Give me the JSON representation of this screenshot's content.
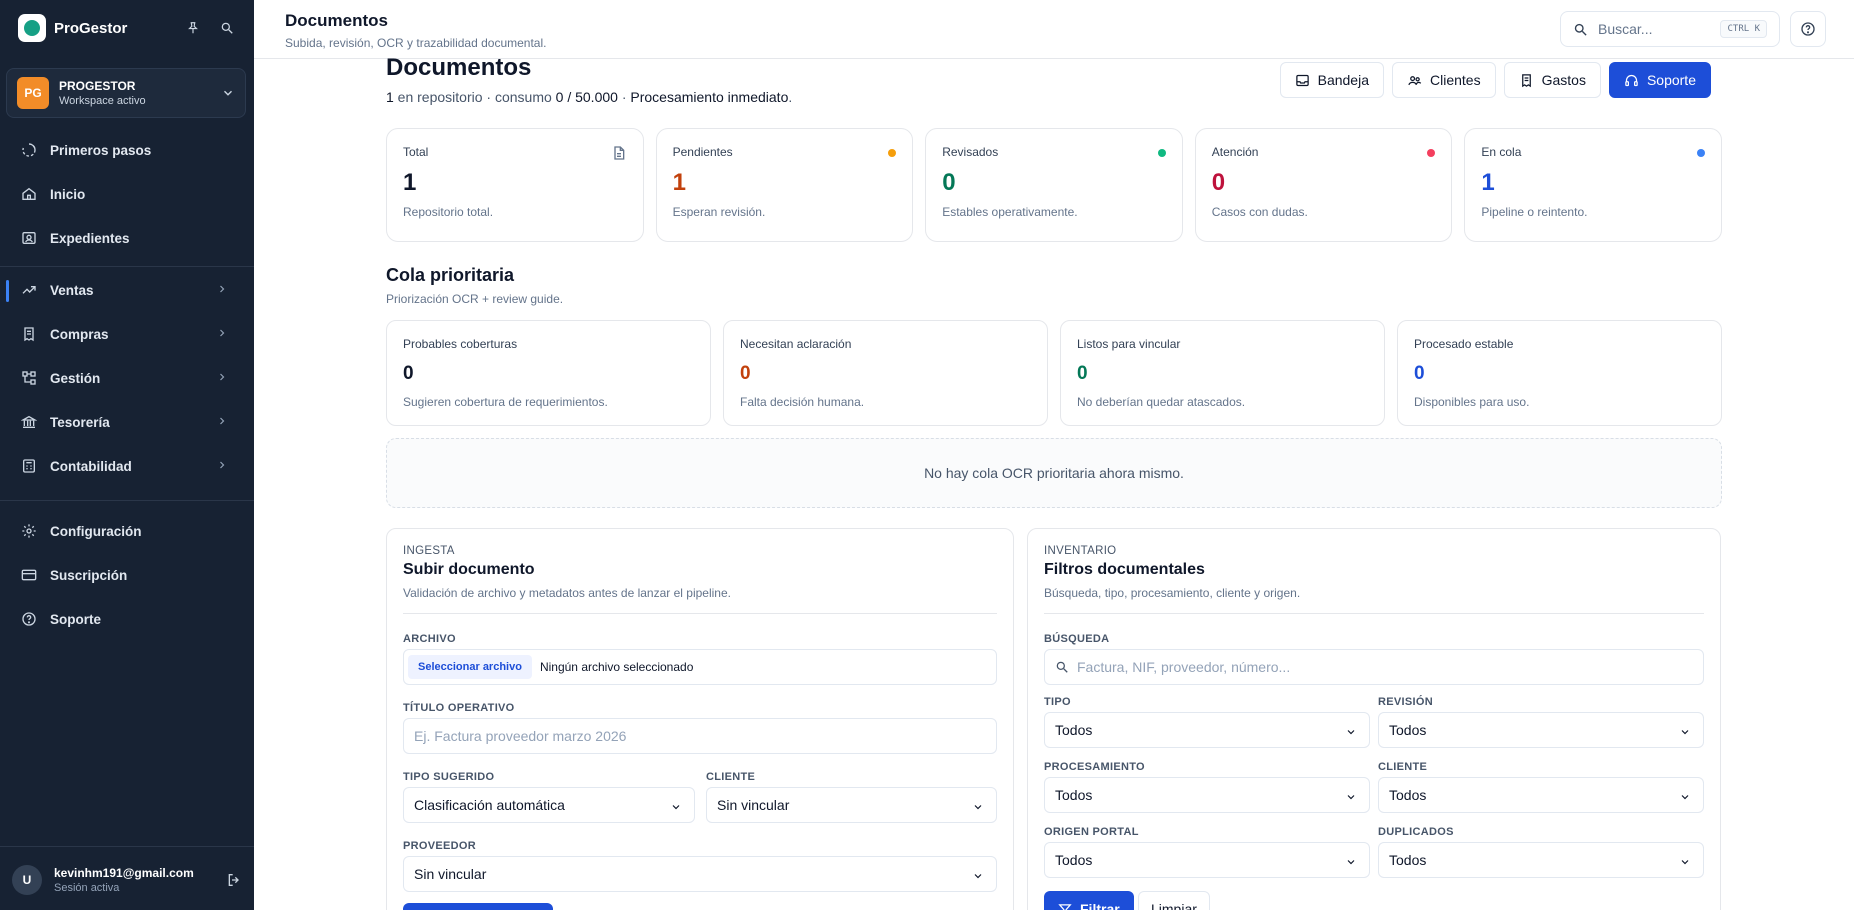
{
  "sidebar": {
    "brand": "ProGestor",
    "workspace": {
      "initials": "PG",
      "name": "PROGESTOR",
      "status": "Workspace activo"
    },
    "items": [
      {
        "label": "Primeros pasos",
        "icon": "circle-progress-icon"
      },
      {
        "label": "Inicio",
        "icon": "home-icon"
      },
      {
        "label": "Expedientes",
        "icon": "folder-user-icon"
      },
      {
        "label": "Ventas",
        "icon": "trending-up-icon"
      },
      {
        "label": "Compras",
        "icon": "receipt-icon"
      },
      {
        "label": "Gestión",
        "icon": "workflow-icon"
      },
      {
        "label": "Tesorería",
        "icon": "bank-icon"
      },
      {
        "label": "Contabilidad",
        "icon": "calculator-icon"
      },
      {
        "label": "Configuración",
        "icon": "gear-icon"
      },
      {
        "label": "Suscripción",
        "icon": "credit-card-icon"
      },
      {
        "label": "Soporte",
        "icon": "help-circle-icon"
      }
    ],
    "user": {
      "initial": "U",
      "email": "kevinhm191@gmail.com",
      "status": "Sesión activa"
    }
  },
  "header": {
    "title": "Documentos",
    "subtitle": "Subida, revisión, OCR y trazabilidad documental.",
    "search_placeholder": "Buscar...",
    "shortcut": "CTRL K"
  },
  "page": {
    "title": "Documentos",
    "repo_count": "1",
    "repo_text": " en repositorio · consumo ",
    "usage": "0 / 50.000",
    "processing_sep": " · ",
    "processing": "Procesamiento inmediato",
    "processing_end": ".",
    "actions": [
      "Bandeja",
      "Clientes",
      "Gastos",
      "Soporte"
    ]
  },
  "stats": [
    {
      "label": "Total",
      "value": "1",
      "desc": "Repositorio total.",
      "color": "#0f172a"
    },
    {
      "label": "Pendientes",
      "value": "1",
      "desc": "Esperan revisión.",
      "color": "#c2410c",
      "dot": "#f59e0b"
    },
    {
      "label": "Revisados",
      "value": "0",
      "desc": "Estables operativamente.",
      "color": "#047857",
      "dot": "#10b981"
    },
    {
      "label": "Atención",
      "value": "0",
      "desc": "Casos con dudas.",
      "color": "#be123c",
      "dot": "#f43f5e"
    },
    {
      "label": "En cola",
      "value": "1",
      "desc": "Pipeline o reintento.",
      "color": "#1d4ed8",
      "dot": "#3b82f6"
    }
  ],
  "queue": {
    "title": "Cola prioritaria",
    "subtitle": "Priorización OCR + review guide.",
    "cards": [
      {
        "label": "Probables coberturas",
        "value": "0",
        "desc": "Sugieren cobertura de requerimientos.",
        "color": "#0f172a"
      },
      {
        "label": "Necesitan aclaración",
        "value": "0",
        "desc": "Falta decisión humana.",
        "color": "#c2410c"
      },
      {
        "label": "Listos para vincular",
        "value": "0",
        "desc": "No deberían quedar atascados.",
        "color": "#047857"
      },
      {
        "label": "Procesado estable",
        "value": "0",
        "desc": "Disponibles para uso.",
        "color": "#1d4ed8"
      }
    ],
    "empty": "No hay cola OCR prioritaria ahora mismo."
  },
  "ingesta": {
    "eyebrow": "INGESTA",
    "title": "Subir documento",
    "subtitle": "Validación de archivo y metadatos antes de lanzar el pipeline.",
    "file_label": "ARCHIVO",
    "file_button": "Seleccionar archivo",
    "file_none": "Ningún archivo seleccionado",
    "title_label": "TÍTULO OPERATIVO",
    "title_placeholder": "Ej. Factura proveedor marzo 2026",
    "type_label": "TIPO SUGERIDO",
    "type_value": "Clasificación automática",
    "client_label": "CLIENTE",
    "client_value": "Sin vincular",
    "provider_label": "PROVEEDOR",
    "provider_value": "Sin vincular"
  },
  "inventario": {
    "eyebrow": "INVENTARIO",
    "title": "Filtros documentales",
    "subtitle": "Búsqueda, tipo, procesamiento, cliente y origen.",
    "search_label": "BÚSQUEDA",
    "search_placeholder": "Factura, NIF, proveedor, número...",
    "filters": [
      {
        "label": "TIPO",
        "value": "Todos"
      },
      {
        "label": "REVISIÓN",
        "value": "Todos"
      },
      {
        "label": "PROCESAMIENTO",
        "value": "Todos"
      },
      {
        "label": "CLIENTE",
        "value": "Todos"
      },
      {
        "label": "ORIGEN PORTAL",
        "value": "Todos"
      },
      {
        "label": "DUPLICADOS",
        "value": "Todos"
      }
    ],
    "filter_button": "Filtrar",
    "clear_button": "Limpiar"
  },
  "colors": {
    "sidebar_bg": "#172233",
    "primary": "#1d4ed8",
    "workspace_avatar": "#f28c28"
  }
}
